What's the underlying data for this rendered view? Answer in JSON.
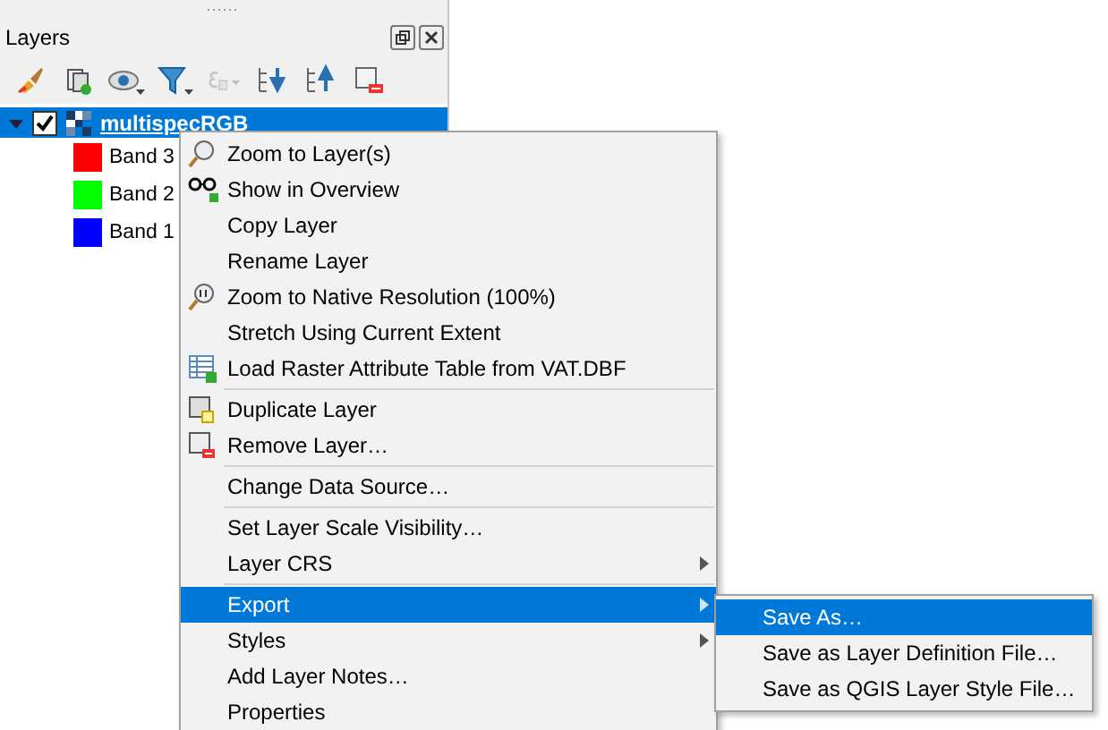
{
  "panel": {
    "title": "Layers"
  },
  "toolbar": [
    {
      "kind": "brush",
      "disabled": false
    },
    {
      "kind": "group",
      "disabled": false
    },
    {
      "kind": "eye",
      "disabled": false
    },
    {
      "kind": "filter",
      "disabled": false
    },
    {
      "kind": "expression",
      "disabled": true
    },
    {
      "kind": "expand",
      "disabled": false
    },
    {
      "kind": "collapse",
      "disabled": false
    },
    {
      "kind": "remove",
      "disabled": false
    }
  ],
  "layer": {
    "name": "multispecRGB",
    "expanded": true,
    "checked": true,
    "selected": true,
    "children": [
      {
        "name": "Band 3",
        "color": "#ff0000"
      },
      {
        "name": "Band 2",
        "color": "#00ff00"
      },
      {
        "name": "Band 1",
        "color": "#0000ff"
      }
    ]
  },
  "context_menu": [
    {
      "kind": "item",
      "label": "Zoom to Layer(s)",
      "submenu": false,
      "selected": false
    },
    {
      "kind": "item",
      "label": "Show in Overview",
      "submenu": false,
      "selected": false
    },
    {
      "kind": "item",
      "label": "Copy Layer",
      "submenu": false,
      "selected": false
    },
    {
      "kind": "item",
      "label": "Rename Layer",
      "submenu": false,
      "selected": false
    },
    {
      "kind": "item",
      "label": "Zoom to Native Resolution (100%)",
      "submenu": false,
      "selected": false
    },
    {
      "kind": "item",
      "label": "Stretch Using Current Extent",
      "submenu": false,
      "selected": false
    },
    {
      "kind": "item",
      "label": "Load Raster Attribute Table from VAT.DBF",
      "submenu": false,
      "selected": false
    },
    {
      "kind": "separator"
    },
    {
      "kind": "item",
      "label": "Duplicate Layer",
      "submenu": false,
      "selected": false
    },
    {
      "kind": "item",
      "label": "Remove Layer…",
      "submenu": false,
      "selected": false
    },
    {
      "kind": "separator"
    },
    {
      "kind": "item",
      "label": "Change Data Source…",
      "submenu": false,
      "selected": false
    },
    {
      "kind": "separator"
    },
    {
      "kind": "item",
      "label": "Set Layer Scale Visibility…",
      "submenu": false,
      "selected": false
    },
    {
      "kind": "item",
      "label": "Layer CRS",
      "submenu": true,
      "selected": false
    },
    {
      "kind": "separator"
    },
    {
      "kind": "item",
      "label": "Export",
      "submenu": true,
      "selected": true
    },
    {
      "kind": "item",
      "label": "Styles",
      "submenu": true,
      "selected": false
    },
    {
      "kind": "item",
      "label": "Add Layer Notes…",
      "submenu": false,
      "selected": false
    },
    {
      "kind": "item",
      "label": "Properties",
      "submenu": false,
      "selected": false
    }
  ],
  "export_submenu": [
    {
      "label": "Save As…",
      "selected": true
    },
    {
      "label": "Save as Layer Definition File…",
      "selected": false
    },
    {
      "label": "Save as QGIS Layer Style File…",
      "selected": false
    }
  ]
}
